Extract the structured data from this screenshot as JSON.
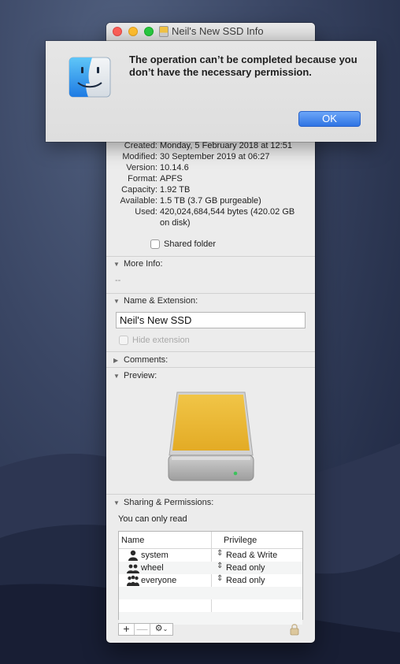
{
  "window": {
    "title": "Neil's New SSD Info"
  },
  "alert": {
    "message": "The operation can’t be completed because you don’t have the necessary permission.",
    "ok_label": "OK",
    "icon": "finder-icon"
  },
  "general": {
    "rows": [
      {
        "key": "Created:",
        "value": "Monday, 5 February 2018 at 12:51"
      },
      {
        "key": "Modified:",
        "value": "30 September 2019 at 06:27"
      },
      {
        "key": "Version:",
        "value": "10.14.6"
      },
      {
        "key": "Format:",
        "value": "APFS"
      },
      {
        "key": "Capacity:",
        "value": "1.92 TB"
      },
      {
        "key": "Available:",
        "value": "1.5 TB (3.7 GB purgeable)"
      },
      {
        "key": "Used:",
        "value": "420,024,684,544 bytes (420.02 GB on disk)"
      }
    ],
    "shared_folder_label": "Shared folder",
    "shared_folder_checked": false
  },
  "more_info": {
    "header": "More Info:",
    "value": "--"
  },
  "name_extension": {
    "header": "Name & Extension:",
    "name_value": "Neil's New SSD",
    "hide_extension_label": "Hide extension",
    "hide_extension_checked": false
  },
  "comments": {
    "header": "Comments:"
  },
  "preview": {
    "header": "Preview:",
    "icon": "external-drive-icon"
  },
  "sharing": {
    "header": "Sharing & Permissions:",
    "status": "You can only read",
    "columns": [
      "Name",
      "Privilege"
    ],
    "rows": [
      {
        "name": "system",
        "privilege": "Read & Write",
        "icon": "single-user-icon"
      },
      {
        "name": "wheel",
        "privilege": "Read only",
        "icon": "group-icon"
      },
      {
        "name": "everyone",
        "privilege": "Read only",
        "icon": "everyone-icon"
      }
    ],
    "toolbar": {
      "add": "+",
      "remove": "—",
      "gear": "⚙"
    }
  },
  "colors": {
    "accent": "#2f74e3",
    "drive_top": "#f2c344",
    "led": "#3cc25c"
  }
}
